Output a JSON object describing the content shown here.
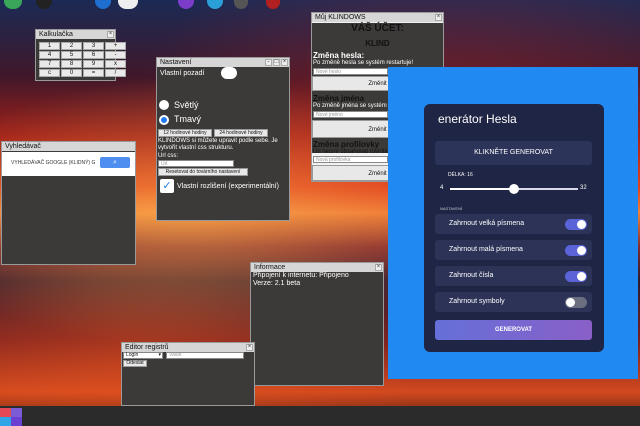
{
  "calculator": {
    "title": "Kalkulačka",
    "keys": [
      "1",
      "2",
      "3",
      "+",
      "4",
      "5",
      "6",
      "-",
      "7",
      "8",
      "9",
      "x",
      "c",
      "0",
      "=",
      "/"
    ]
  },
  "search": {
    "title": "Vyhledávač",
    "query": "VYHLEDÁVAČ GOOGLE (KLIDNÝ) Goo",
    "button_icon": "search-icon"
  },
  "settings": {
    "title": "Nastavení",
    "wallpaper_label": "Vlastní pozadí",
    "theme_light": "Světlý",
    "theme_dark": "Tmavý",
    "clock_12": "12 hodinové hodiny",
    "clock_24": "24 hodinové hodiny",
    "css_text": "KLINDOWS si můžete upravit podle sebe. Je vytvořit vlastní css strukturu.",
    "css_url_label": "Url css:",
    "css_url_placeholder": "Url",
    "reset_label": "Resetovat do továrního nastavení",
    "experimental_label": "Vlastní rozlišení (experimentální)"
  },
  "account": {
    "title": "Můj KLINDOWS",
    "heading": "VÁŠ ÚČET:",
    "username": "KLIND",
    "pass_heading": "Změna hesla:",
    "pass_note": "Po změně hesla se systém restartuje!",
    "pass_placeholder": "Nové heslo",
    "name_heading": "Změna jména",
    "name_note": "Po změně jména se systém restartuje!",
    "name_placeholder": "Nové jméno",
    "pic_heading": "Změna profilovky",
    "pic_note": "Url nesmí obsahovat rovnítko",
    "pic_placeholder": "Nová profilovka",
    "change_label": "Změnit"
  },
  "info": {
    "title": "Informace",
    "internet": "Připojení k internetu: Připojeno",
    "version": "Verze: 2.1 beta"
  },
  "registry": {
    "title": "Editor registrů",
    "key_selected": "Login",
    "value_placeholder": "Value",
    "submit_label": "Odeslat"
  },
  "generator": {
    "title": "enerátor Hesla",
    "copy_label": "KLIKNĚTE GENEROVAT",
    "length_label": "DÉLKA: 16",
    "slider_min": "4",
    "slider_max": "32",
    "length_fraction": 0.5,
    "settings_label": "NASTAVENÍ",
    "options": [
      {
        "label": "Zahrnout velká písmena",
        "on": true
      },
      {
        "label": "Zahrnout malá písmena",
        "on": true
      },
      {
        "label": "Zahrnout čísla",
        "on": true
      },
      {
        "label": "Zahrnout symboly",
        "on": false
      }
    ],
    "generate_label": "GENEROVAT",
    "accent": "#5a64d8"
  },
  "start_colors": [
    "#e74856",
    "#7b5cd6",
    "#2fa5e8",
    "#6b3fd1"
  ]
}
